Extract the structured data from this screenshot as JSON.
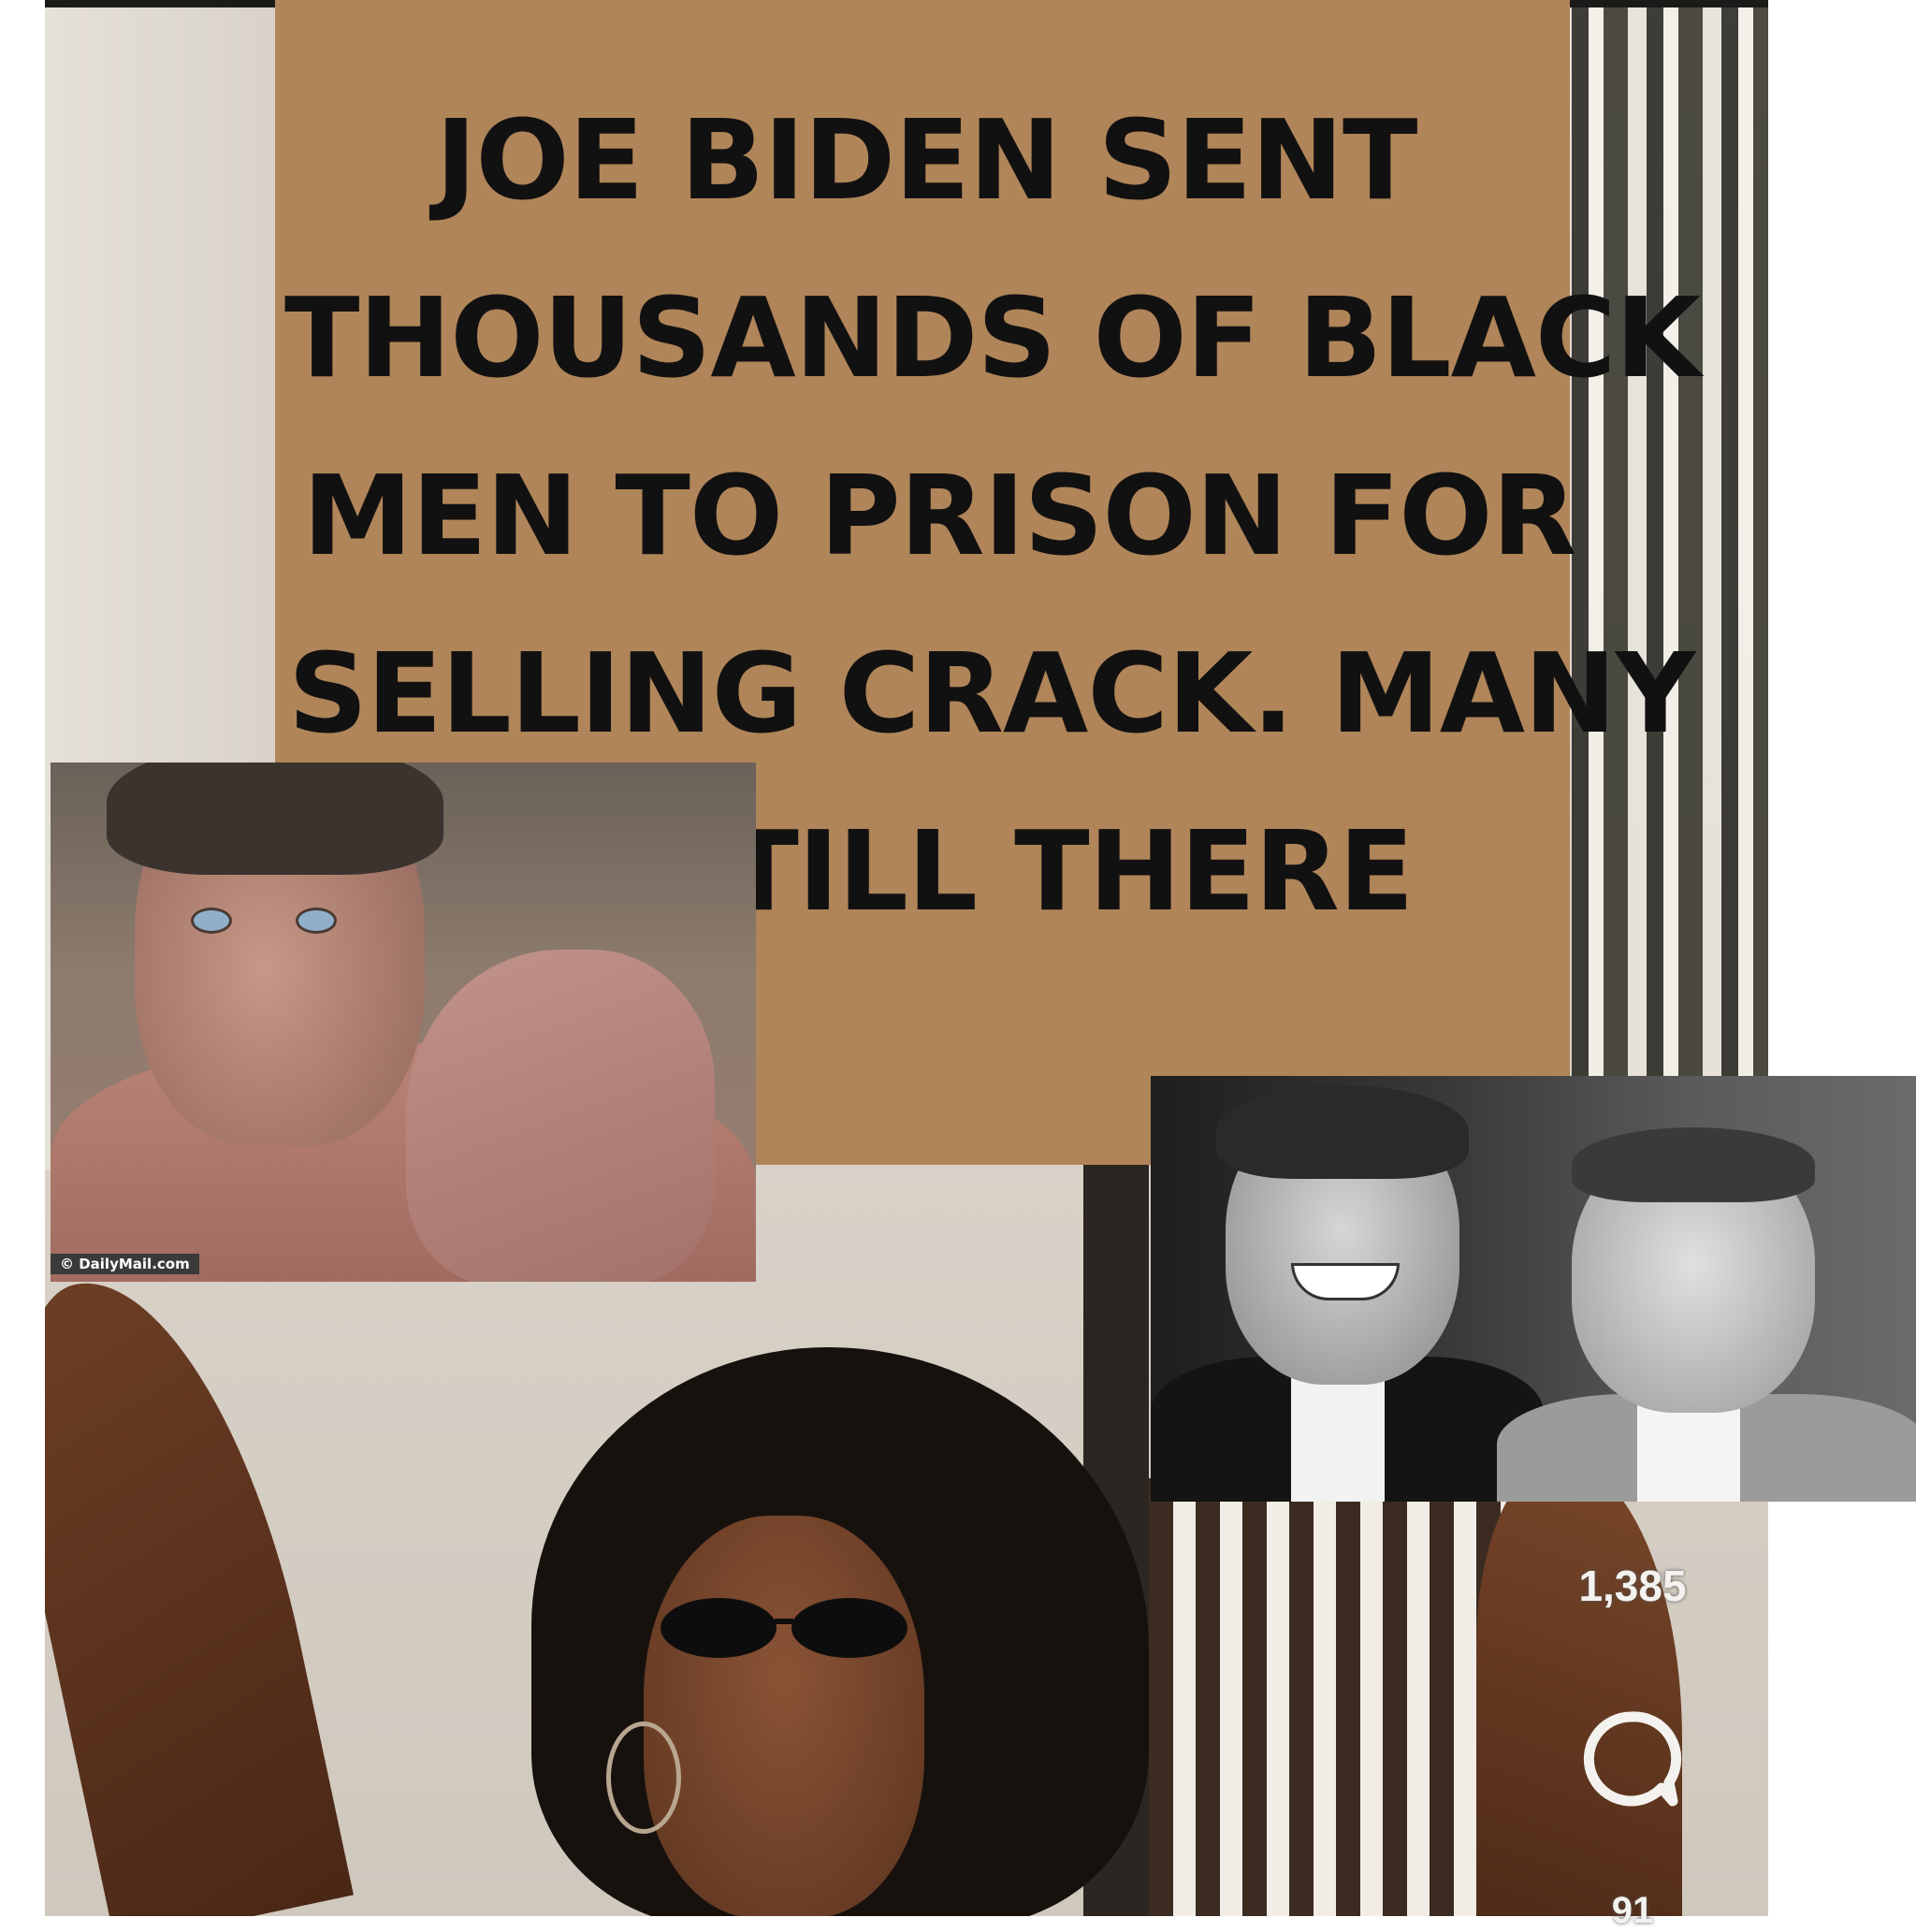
{
  "caption": {
    "lines": [
      "JOE BIDEN SENT",
      "THOUSANDS OF BLACK",
      "MEN TO PRISON FOR",
      "SELLING CRACK.  MANY",
      "ARE STILL THERE"
    ],
    "background_color": "#b08559",
    "text_color": "#121111"
  },
  "inset_photo": {
    "watermark": "© DailyMail.com"
  },
  "social_overlay": {
    "likes_count": "1,385",
    "comments_count": "91",
    "icon": "comment-icon"
  }
}
